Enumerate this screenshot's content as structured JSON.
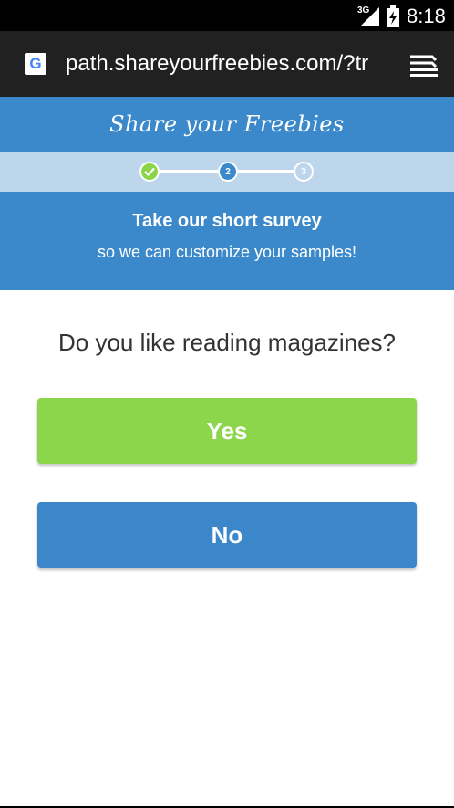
{
  "status_bar": {
    "network": "3G",
    "time": "8:18"
  },
  "browser": {
    "favicon_letter": "G",
    "url": "path.shareyourfreebies.com/?tr"
  },
  "brand": {
    "name": "Share your Freebies"
  },
  "progress": {
    "steps": [
      {
        "label": "",
        "state": "done"
      },
      {
        "label": "2",
        "state": "active"
      },
      {
        "label": "3",
        "state": "pending"
      }
    ]
  },
  "intro": {
    "title": "Take our short survey",
    "subtitle": "so we can customize your samples!"
  },
  "question": {
    "text": "Do you like reading magazines?"
  },
  "answers": {
    "yes_label": "Yes",
    "no_label": "No"
  },
  "colors": {
    "header_blue": "#3b89ca",
    "progress_bg": "#bdd6ec",
    "yes_green": "#8cd64b",
    "no_blue": "#3b87c9"
  }
}
